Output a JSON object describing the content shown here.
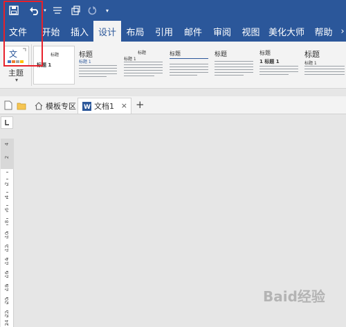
{
  "tabs": [
    {
      "label": "文件",
      "active": false
    },
    {
      "label": "开始",
      "active": false
    },
    {
      "label": "插入",
      "active": false
    },
    {
      "label": "设计",
      "active": true
    },
    {
      "label": "布局",
      "active": false
    },
    {
      "label": "引用",
      "active": false
    },
    {
      "label": "邮件",
      "active": false
    },
    {
      "label": "审阅",
      "active": false
    },
    {
      "label": "视图",
      "active": false
    },
    {
      "label": "美化大师",
      "active": false
    },
    {
      "label": "帮助",
      "active": false
    }
  ],
  "ribbon": {
    "theme_label": "主题",
    "style_cards": [
      {
        "title": "标题",
        "heading": "标题 1"
      },
      {
        "title": "标题",
        "heading": "标题 1"
      },
      {
        "title": "标题",
        "heading": "标题 1"
      },
      {
        "title": "标题",
        "heading": ""
      },
      {
        "title": "标题",
        "heading": ""
      },
      {
        "title": "标题",
        "heading": "标题 1"
      },
      {
        "title": "标题",
        "heading": "1 标题 1"
      },
      {
        "title": "标题",
        "heading": "标题 1"
      }
    ]
  },
  "doc_tabs": [
    {
      "label": "模板专区"
    },
    {
      "label": "文档1"
    }
  ],
  "ruler": {
    "labels": [
      "4",
      "2",
      "2",
      "4",
      "6",
      "8",
      "10",
      "12",
      "14",
      "16",
      "18",
      "20",
      "22",
      "24"
    ]
  },
  "watermark": "Baid经验",
  "colors": {
    "accent": "#2b579a",
    "highlight": "#e8202a",
    "ribbon_bg": "#f3f3f3"
  }
}
